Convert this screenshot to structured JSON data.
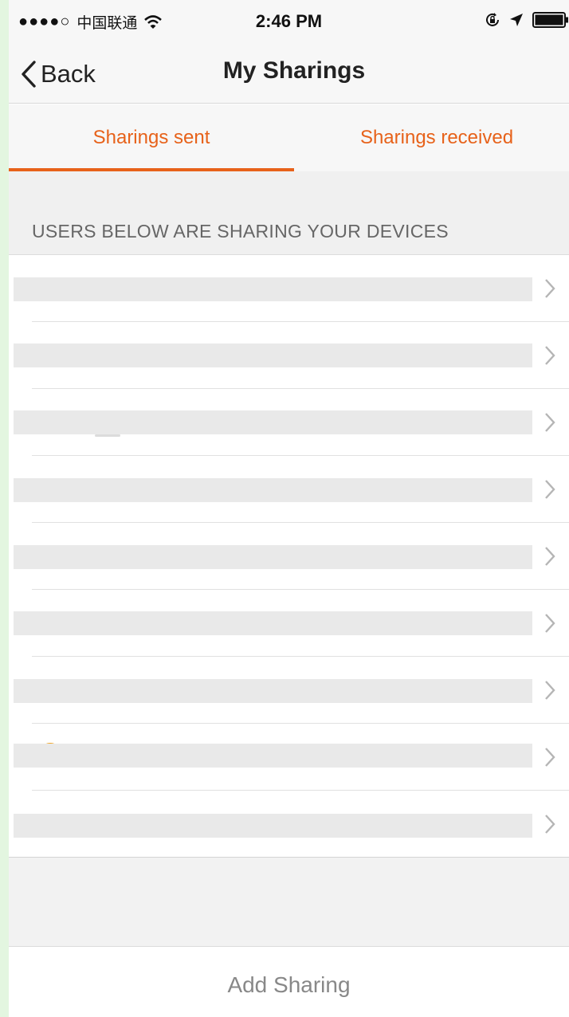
{
  "status_bar": {
    "signal": "●●●●○",
    "carrier": "中国联通",
    "time": "2:46 PM"
  },
  "nav": {
    "back_label": "Back",
    "title": "My Sharings"
  },
  "tabs": [
    {
      "label": "Sharings sent",
      "active": true
    },
    {
      "label": "Sharings received",
      "active": false
    }
  ],
  "section": {
    "title": "USERS BELOW ARE SHARING YOUR DEVICES"
  },
  "list_item_count": 9,
  "footer": {
    "add_label": "Add Sharing"
  },
  "colors": {
    "accent": "#e7621a",
    "avatar": "#f0a526"
  },
  "icons": [
    "wifi-icon",
    "rotation-lock-icon",
    "location-arrow-icon",
    "battery-icon",
    "back-chevron-icon",
    "chevron-right-icon"
  ]
}
